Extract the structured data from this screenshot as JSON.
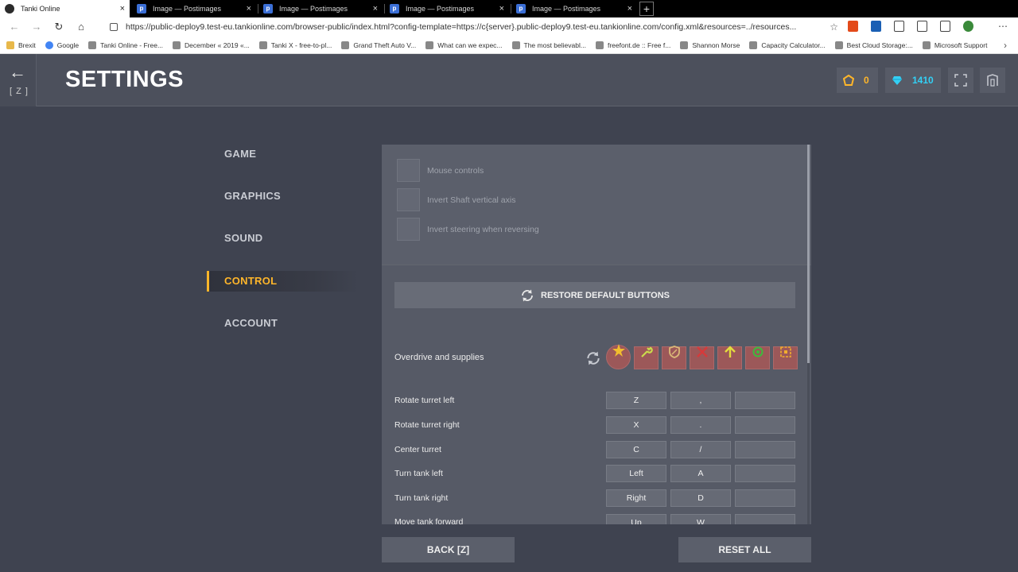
{
  "browser": {
    "tabs": [
      {
        "title": "Tanki Online",
        "active": true
      },
      {
        "title": "Image — Postimages",
        "active": false
      },
      {
        "title": "Image — Postimages",
        "active": false
      },
      {
        "title": "Image — Postimages",
        "active": false
      },
      {
        "title": "Image — Postimages",
        "active": false
      }
    ],
    "new_tab": "+",
    "url": "https://public-deploy9.test-eu.tankionline.com/browser-public/index.html?config-template=https://c{server}.public-deploy9.test-eu.tankionline.com/config.xml&resources=../resources...",
    "bookmarks": [
      "Brexit",
      "Google",
      "Tanki Online - Free...",
      "December « 2019 «...",
      "Tanki X - free-to-pl...",
      "Grand Theft Auto V...",
      "What can we expec...",
      "The most believabl...",
      "freefont.de :: Free f...",
      "Shannon Morse",
      "Capacity Calculator...",
      "Best Cloud Storage:...",
      "Microsoft Support"
    ]
  },
  "header": {
    "back_hotkey": "[ Z ]",
    "title": "SETTINGS",
    "crystals": "0",
    "diamonds": "1410"
  },
  "menu": {
    "items": [
      "GAME",
      "GRAPHICS",
      "SOUND",
      "CONTROL",
      "ACCOUNT"
    ],
    "active": "CONTROL"
  },
  "panel": {
    "checkboxes": [
      {
        "label": "Mouse controls",
        "checked": false
      },
      {
        "label": "Invert Shaft vertical axis",
        "checked": false
      },
      {
        "label": "Invert steering when reversing",
        "checked": false
      }
    ],
    "restore_label": "RESTORE DEFAULT BUTTONS",
    "overdrive_label": "Overdrive and supplies",
    "controls": [
      {
        "label": "Rotate turret left",
        "keys": [
          "Z",
          ",",
          ""
        ]
      },
      {
        "label": "Rotate turret right",
        "keys": [
          "X",
          ".",
          ""
        ]
      },
      {
        "label": "Center turret",
        "keys": [
          "C",
          "/",
          ""
        ]
      },
      {
        "label": "Turn tank left",
        "keys": [
          "Left",
          "A",
          ""
        ]
      },
      {
        "label": "Turn tank right",
        "keys": [
          "Right",
          "D",
          ""
        ]
      },
      {
        "label": "Move tank forward",
        "keys": [
          "Up",
          "W",
          ""
        ]
      }
    ]
  },
  "buttons": {
    "back": "BACK [Z]",
    "reset": "RESET ALL"
  },
  "colors": {
    "accent": "#ffb62a",
    "diamond": "#33d0f5",
    "background": "#3f4350",
    "panel": "#565a66",
    "supply_slot": "#a35858"
  }
}
